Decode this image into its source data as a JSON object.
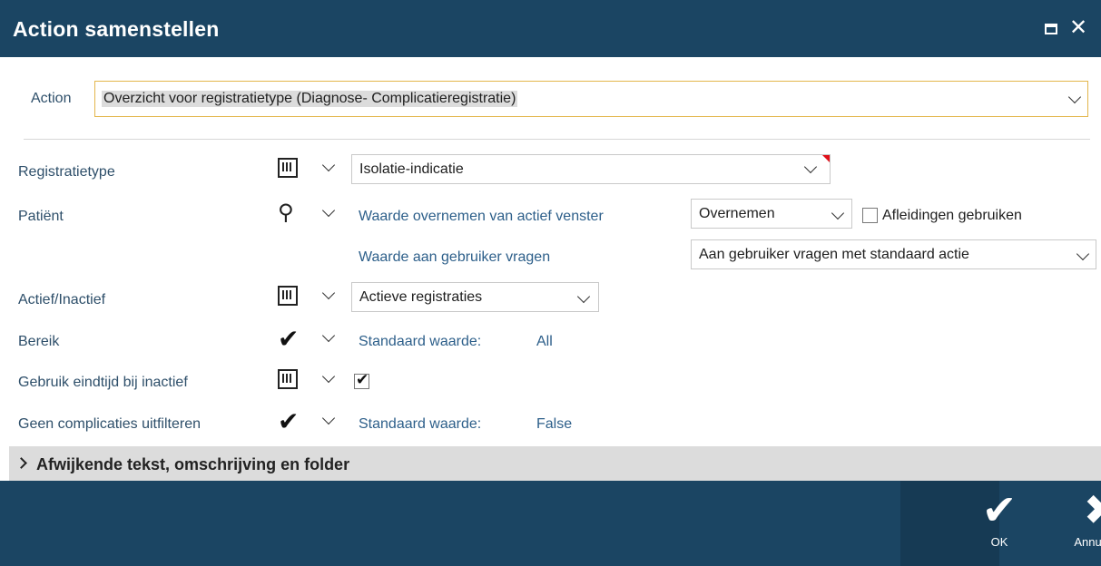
{
  "window": {
    "title": "Action samenstellen"
  },
  "action": {
    "label": "Action",
    "value": "Overzicht voor registratietype (Diagnose- Complicatieregistratie)"
  },
  "fields": {
    "registratietype": {
      "label": "Registratietype",
      "value": "Isolatie-indicatie"
    },
    "patient": {
      "label": "Patiënt",
      "row1_text": "Waarde overnemen van actief venster",
      "row1_value": "Overnemen",
      "afleidingen_label": "Afleidingen gebruiken",
      "row2_text": "Waarde aan gebruiker vragen",
      "row2_value": "Aan gebruiker vragen met standaard actie"
    },
    "actief": {
      "label": "Actief/Inactief",
      "value": "Actieve registraties"
    },
    "bereik": {
      "label": "Bereik",
      "default_label": "Standaard waarde:",
      "default_value": "All"
    },
    "eindtijd": {
      "label": "Gebruik eindtijd bij inactief",
      "checked": true
    },
    "complicaties": {
      "label": "Geen complicaties uitfilteren",
      "default_label": "Standaard waarde:",
      "default_value": "False"
    }
  },
  "section": {
    "label": "Afwijkende tekst, omschrijving en folder"
  },
  "footer": {
    "ok_label": "OK",
    "cancel_label": "Annuleren"
  },
  "icons": {
    "maximize": "maximize-icon",
    "close": "close-icon",
    "chevron": "chevron-down-icon"
  },
  "colors": {
    "titlebar": "#1b4563",
    "accent": "#e3b64c",
    "label": "#2e4f6a"
  }
}
